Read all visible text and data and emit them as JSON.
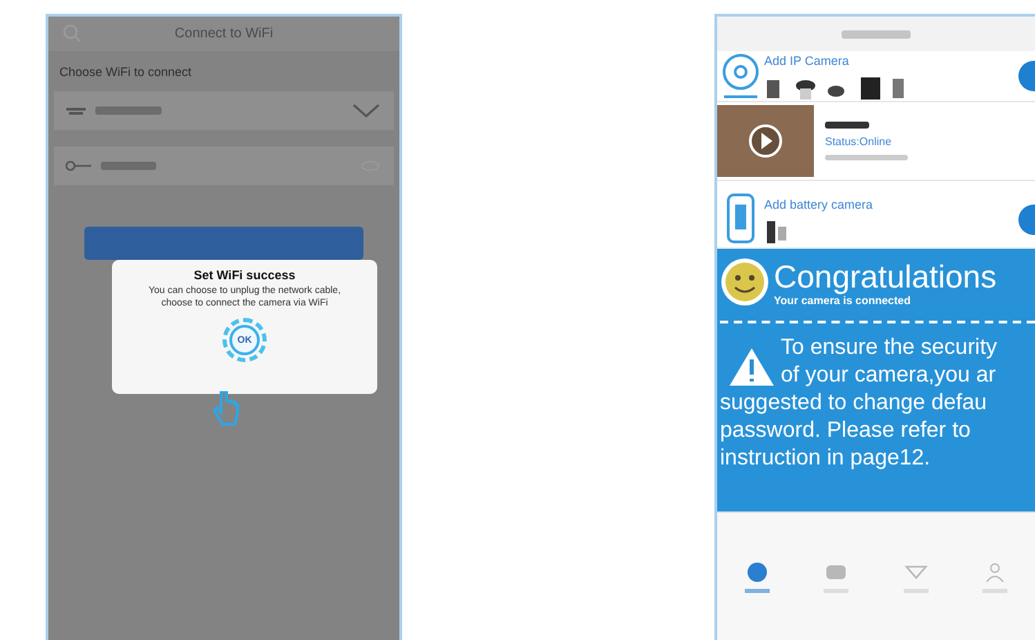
{
  "wifi_screen": {
    "title": "Connect to WiFi",
    "prompt": "Choose WiFi to connect",
    "dialog": {
      "title": "Set WiFi success",
      "message": "You can choose to unplug the network cable, choose to connect the camera via WiFi",
      "button": "OK"
    }
  },
  "camera_screen": {
    "rows": [
      {
        "kind": "add_ip",
        "label": "Add IP Camera"
      },
      {
        "kind": "camera",
        "status": "Status:Online"
      },
      {
        "kind": "add_battery",
        "label": "Add battery camera"
      }
    ],
    "banner": {
      "title": "Congratulations",
      "subtitle": "Your camera is connected",
      "warning_lines": [
        "To ensure the security",
        "of your camera,you ar",
        "suggested to change defau",
        "password. Please refer to",
        "instruction in page12."
      ]
    },
    "tabs": [
      {
        "selected": true
      },
      {
        "selected": false
      },
      {
        "selected": false
      },
      {
        "selected": false
      }
    ]
  }
}
